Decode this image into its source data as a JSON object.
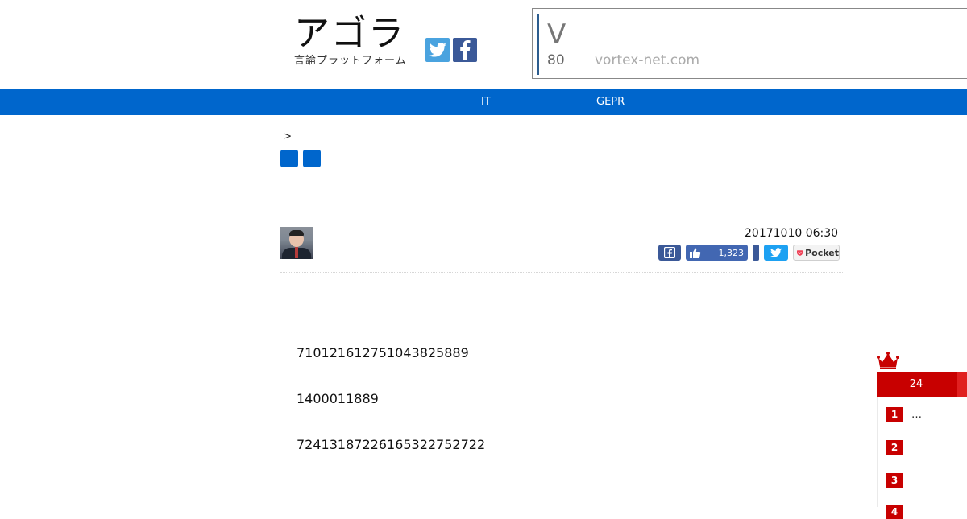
{
  "header": {
    "logo_title": "アゴラ",
    "logo_subtitle": "言論プラットフォーム"
  },
  "ad": {
    "letter": "V",
    "number": "80",
    "domain": "vortex-net.com"
  },
  "nav": {
    "items": [
      {
        "label": "IT"
      },
      {
        "label": "GEPR"
      }
    ],
    "color": "#0066cc"
  },
  "breadcrumb": ">",
  "article": {
    "date": "20171010 06:30",
    "like_count": "1,323",
    "pocket_label": "Pocket",
    "paragraphs": [
      "7101216127510438258​89",
      "1400011889",
      "724131872261653227527​22"
    ]
  },
  "ranking": {
    "header_label": "24",
    "accent": "#c80000",
    "items": [
      {
        "rank": "1",
        "text": "…"
      },
      {
        "rank": "2",
        "text": ""
      },
      {
        "rank": "3",
        "text": ""
      },
      {
        "rank": "4",
        "text": ""
      }
    ]
  }
}
